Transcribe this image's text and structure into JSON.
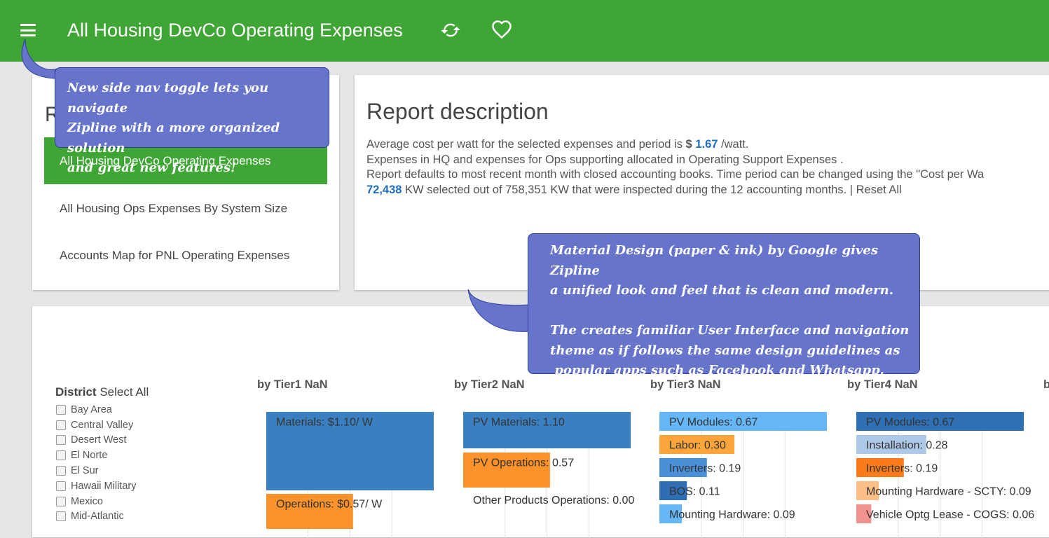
{
  "app": {
    "title": "All Housing DevCo Operating Expenses",
    "menu_icon": "menu-icon",
    "refresh_icon": "refresh-icon",
    "favorite_icon": "heart-icon",
    "brand_color": "#3fa535"
  },
  "nav_card": {
    "heading": "R",
    "items": [
      {
        "label": "All Housing DevCo Operating Expenses",
        "active": true
      },
      {
        "label": "All Housing Ops Expenses By System Size",
        "active": false
      },
      {
        "label": "Accounts Map for PNL Operating Expenses",
        "active": false
      }
    ]
  },
  "report": {
    "title": "Report description",
    "cost_prefix": "Average cost per watt for the selected expenses and period is ",
    "cost_currency": "$ ",
    "cost_value": "1.67",
    "cost_unit": " /watt.",
    "line2": "Expenses in HQ and expenses for Ops supporting allocated in Operating Support Expenses     .",
    "line3": "Report defaults to most recent month with closed accounting books. Time period can be changed using the \"Cost per Wa",
    "kw_selected": "72,438",
    "kw_rest": " KW selected out of 758,351 KW that were inspected during the 12 accounting months. | ",
    "reset_all": "Reset All"
  },
  "filters": {
    "district_label": "District",
    "select_all": "Select All",
    "districts": [
      "Bay Area",
      "Central Valley",
      "Desert West",
      "El Norte",
      "El Sur",
      "Hawaii Military",
      "Mexico",
      "Mid-Atlantic"
    ]
  },
  "charts": {
    "tier_titles": [
      "by Tier1 NaN",
      "by Tier2 NaN",
      "by Tier3 NaN",
      "by Tier4 NaN",
      "b"
    ]
  },
  "chart_data": [
    {
      "type": "bar",
      "title": "by Tier1 NaN",
      "categories": [
        "Materials",
        "Operations"
      ],
      "values": [
        1.1,
        0.57
      ],
      "labels": [
        "Materials: $1.10/ W",
        "Operations: $0.57/ W"
      ],
      "colors": [
        "#3a7fc0",
        "#fb922c"
      ]
    },
    {
      "type": "bar",
      "title": "by Tier2 NaN",
      "categories": [
        "PV Materials",
        "PV Operations",
        "Other Products Operations"
      ],
      "values": [
        1.1,
        0.57,
        0.0
      ],
      "labels": [
        "PV Materials: 1.10",
        "PV Operations: 0.57",
        "Other Products Operations: 0.00"
      ],
      "colors": [
        "#3a7fc0",
        "#fb922c",
        "#cccccc"
      ]
    },
    {
      "type": "bar",
      "title": "by Tier3 NaN",
      "categories": [
        "PV Modules",
        "Labor",
        "Inverters",
        "BOS",
        "Mounting Hardware"
      ],
      "values": [
        0.67,
        0.3,
        0.19,
        0.11,
        0.09
      ],
      "labels": [
        "PV Modules: 0.67",
        "Labor: 0.30",
        "Inverters: 0.19",
        "BOS: 0.11",
        "Mounting Hardware: 0.09"
      ],
      "colors": [
        "#66b7f5",
        "#fba53a",
        "#4a90d9",
        "#2f6db5",
        "#66b7f5"
      ]
    },
    {
      "type": "bar",
      "title": "by Tier4 NaN",
      "categories": [
        "PV Modules",
        "Installation",
        "Inverters",
        "Mounting Hardware - SCTY",
        "Vehicle Optg Lease - COGS"
      ],
      "values": [
        0.67,
        0.28,
        0.19,
        0.09,
        0.06
      ],
      "labels": [
        "PV Modules: 0.67",
        "Installation: 0.28",
        "Inverters: 0.19",
        "Mounting Hardware - SCTY: 0.09",
        "Vehicle Optg Lease - COGS: 0.06"
      ],
      "colors": [
        "#2f6fb3",
        "#aec8e8",
        "#fb7a1a",
        "#fbbf85",
        "#f2928f"
      ]
    }
  ],
  "callouts": {
    "nav_toggle": [
      "New side nav toggle lets you navigate",
      "Zipline with a more organized solution",
      "and great new features!"
    ],
    "material": [
      "Material Design (paper & ink) by Google gives Zipline",
      "a unified look and feel that is clean and modern.",
      "",
      "The creates familiar User Interface and navigation",
      "theme as if follows the same design guidelines as",
      " popular apps such as Facebook and Whatsapp."
    ]
  }
}
